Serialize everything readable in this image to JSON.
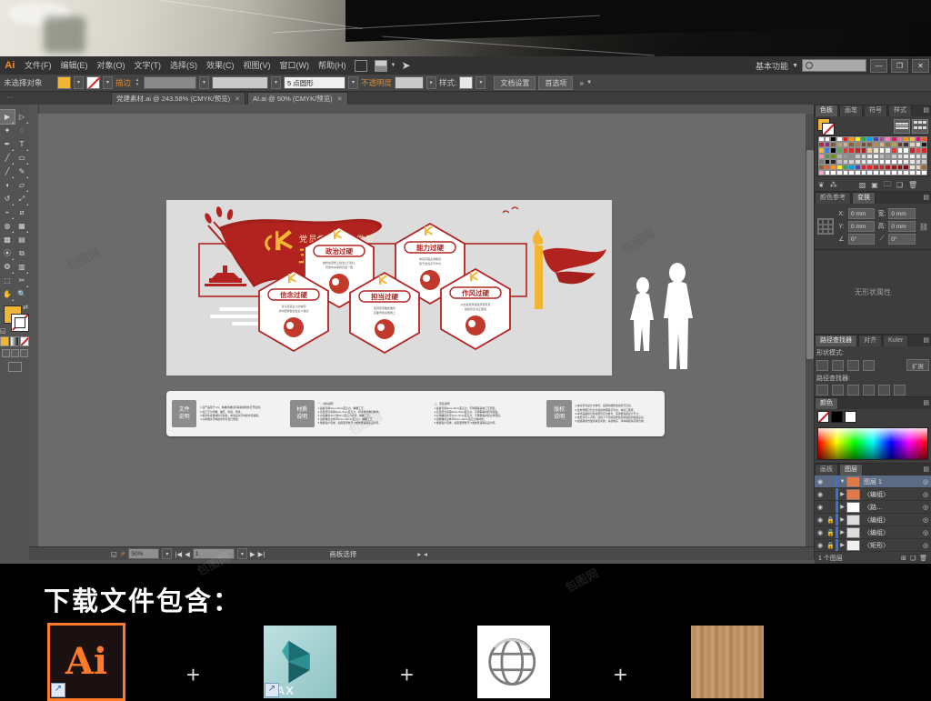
{
  "app": {
    "name": "Ai",
    "workspace": "基本功能",
    "search_placeholder": "",
    "window_buttons": [
      "—",
      "❐",
      "✕"
    ]
  },
  "menubar": {
    "items": [
      "文件(F)",
      "编辑(E)",
      "对象(O)",
      "文字(T)",
      "选择(S)",
      "效果(C)",
      "视图(V)",
      "窗口(W)",
      "帮助(H)"
    ],
    "bridge_icon": "bridge-icon",
    "arrange_icon": "arrange-documents-icon",
    "stock_icon": "stock-icon"
  },
  "optionsbar": {
    "selection_status": "未选择对象",
    "fill_label": "填色",
    "stroke_label": "描边",
    "stroke_weight": "5 点圆形",
    "opacity_label": "不透明度",
    "opacity_value": "100%",
    "style_label": "样式:",
    "doc_setup": "文档设置",
    "preferences": "首选项",
    "more_label": "»"
  },
  "tabs": [
    {
      "title": "党建素材.ai @ 243.58% (CMYK/预览)",
      "active": false,
      "close": "✕"
    },
    {
      "title": "AI.ai @ 50% (CMYK/预览)",
      "active": true,
      "close": "✕"
    }
  ],
  "toolbox": {
    "tools": [
      {
        "name": "selection-tool",
        "glyph": "▶",
        "selected": true
      },
      {
        "name": "direct-selection-tool",
        "glyph": "▷",
        "selected": false
      },
      {
        "name": "magic-wand-tool",
        "glyph": "✦",
        "selected": false
      },
      {
        "name": "lasso-tool",
        "glyph": "◌",
        "selected": false
      },
      {
        "name": "pen-tool",
        "glyph": "✒",
        "selected": false
      },
      {
        "name": "type-tool",
        "glyph": "T",
        "selected": false
      },
      {
        "name": "line-segment-tool",
        "glyph": "／",
        "selected": false
      },
      {
        "name": "rectangle-tool",
        "glyph": "▭",
        "selected": false
      },
      {
        "name": "paintbrush-tool",
        "glyph": "🖌",
        "selected": false
      },
      {
        "name": "pencil-tool",
        "glyph": "✎",
        "selected": false
      },
      {
        "name": "blob-brush-tool",
        "glyph": "◖",
        "selected": false
      },
      {
        "name": "eraser-tool",
        "glyph": "▱",
        "selected": false
      },
      {
        "name": "rotate-tool",
        "glyph": "↺",
        "selected": false
      },
      {
        "name": "scale-tool",
        "glyph": "⤢",
        "selected": false
      },
      {
        "name": "width-tool",
        "glyph": "⌁",
        "selected": false
      },
      {
        "name": "shape-builder-tool",
        "glyph": "◍",
        "selected": false
      },
      {
        "name": "perspective-grid-tool",
        "glyph": "▦",
        "selected": false
      },
      {
        "name": "mesh-tool",
        "glyph": "▤",
        "selected": false
      },
      {
        "name": "gradient-tool",
        "glyph": "▩",
        "selected": false
      },
      {
        "name": "eyedropper-tool",
        "glyph": "⦿",
        "selected": false
      },
      {
        "name": "blend-tool",
        "glyph": "⧉",
        "selected": false
      },
      {
        "name": "symbol-sprayer-tool",
        "glyph": "❂",
        "selected": false
      },
      {
        "name": "column-graph-tool",
        "glyph": "▥",
        "selected": false
      },
      {
        "name": "artboard-tool",
        "glyph": "⬚",
        "selected": false
      },
      {
        "name": "slice-tool",
        "glyph": "✂",
        "selected": false
      },
      {
        "name": "hand-tool",
        "glyph": "✋",
        "selected": false
      },
      {
        "name": "zoom-tool",
        "glyph": "🔍",
        "selected": false
      }
    ],
    "fill_color": "#f2b632",
    "stroke_color": "#ffffff",
    "swap_icon": "swap-fill-stroke-icon",
    "default_icon": "default-fill-stroke-icon"
  },
  "statusbar": {
    "zoom_value": "50%",
    "page_value": "1",
    "status_text": "画板选择",
    "prev_icon": "prev-icon",
    "next_icon": "next-icon"
  },
  "artwork": {
    "headline_small": "党员干部必须做到",
    "headline_big": "五个过硬",
    "hexes": [
      {
        "title": "政治过硬",
        "body": "始终在思想上政治上行动上同党中央保持高度一致"
      },
      {
        "title": "能力过硬",
        "body": "本领高强业务精湛勇于担当善于作为"
      },
      {
        "title": "担当过硬",
        "body": "坚持原则敢抓敢管直面矛盾迎难而上"
      },
      {
        "title": "信念过硬",
        "body": "对马克思主义的信仰对中国特色社会主义的信念"
      },
      {
        "title": "作风过硬",
        "body": "以优良党风促政风带民风勤政务实清正廉洁"
      }
    ],
    "info_blocks": [
      {
        "label": "文件\n说明",
        "lines": [
          "1.设产品用于:  CS、精雕浮雕刻字等常用软件打开使用。",
          "2.如工艺为浮雕、雕花、喷漆、烤漆。",
          "3.模文件多量材料与颜色，单击后文字内容均可编辑。",
          "4.以体图文字体颜色均可自行修改。"
        ]
      },
      {
        "label": "材质\n说明",
        "lines": [
          "一、材料说明",
          "1.底板可用3mm~5mm亚克力、精雕工艺。",
          "2.造型部分采用3mm~5mm亚克力，烤漆或者雕刻制作。",
          "3.文案雕刻3mm到5mm亚克力烤漆，精雕工艺。",
          "4.边框雕刻立体字5mm~10mm亚克力，精雕工艺",
          "5.根据客户需求，如需要调整尺寸或效果请联系设计师，我们可提供免费修改。"
        ]
      },
      {
        "label": "",
        "lines": [
          "二、安装说明",
          "1.底板可用3mm~5mm亚克力、不锈钢等多种工艺安装。",
          "2.造型部分采用3mm~5mm亚克力，不锈钢等材质背胶贴。",
          "3.立体雕刻文字3mm~5mm亚克力，不锈钢等材质立体安装。",
          "4.边框雕刻立体字5mm~10mm亚克力等材质。",
          "5.根据客户需求，如需要调整尺寸或效果请联系设计师，我们可提供免费修改。"
        ]
      },
      {
        "label": "版权\n说明",
        "lines": [
          "1.本文件为设计方参考，如需中国修改请另行洽谈。",
          "2.此效果图只代表方案的效果展示平台，非加工图纸。",
          "3.本作品版权归作者所有仅为参考，需详细沟通设计尺寸，制作方提供施工单。",
          "4.未经许可入声明，任何人不可擅自修改及转载如约侵权必究 (请商议授权)。",
          "5.如遇其他方面需求及问题，请在购买、详单等相关问题咨询，我们诚挚合作作品的设计作品。"
        ]
      }
    ]
  },
  "panels": {
    "swatches": {
      "tabs": [
        "色板",
        "画笔",
        "符号",
        "样式"
      ],
      "active_tab": "色板",
      "menu_icon": "panel-menu-icon",
      "list_view_icon": "list-view-icon",
      "grid_view_icon": "grid-view-icon",
      "footer_icons": [
        "swatch-library-icon",
        "color-group-icon",
        "show-kinds-icon",
        "swatch-options-icon",
        "new-color-group-icon",
        "new-swatch-icon",
        "delete-swatch-icon"
      ],
      "colors": [
        "#ffffff",
        "#ffffff",
        "#000000",
        "#ffffff",
        "#ed1c24",
        "#f7941e",
        "#fff200",
        "#22b14c",
        "#00a2e8",
        "#3f48cc",
        "#a349a4",
        "#ff7fbf",
        "#ed145b",
        "#f06eaa",
        "#f7941e",
        "#fdbb30",
        "#ec008c",
        "#f15a24",
        "#c1272d",
        "#93278f",
        "#7a5c3e",
        "#b9a074",
        "#c7b299",
        "#8c6239",
        "#a67c52",
        "#6f4e37",
        "#7d5a3c",
        "#b08d57",
        "#d9b382",
        "#8a6f48",
        "#b5a642",
        "#5c4033",
        "#3b2f2f",
        "#e6d2b5",
        "#efe3cf",
        "#1b1b1b",
        "#f2b632",
        "#2b7fff",
        "#000000",
        "#4caf50",
        "#e53935",
        "#d32f2f",
        "#c62828",
        "#b71c1c",
        "#e0c9a6",
        "#f1e2c6",
        "#ffffff",
        "#e9e9e9",
        "#ff2d2d",
        "#ffffff",
        "#ffffff",
        "#d42020",
        "#ef4444",
        "#dc2626",
        "#ff8fab",
        "#4e944f",
        "#6b8e23",
        "#b0b0b0",
        "#9a9a9a",
        "#8a8a8a",
        "#c8c8c8",
        "#d8d8d8",
        "#e8e8e8",
        "#f0f0f0",
        "#bdbdbd",
        "#a0a0a0",
        "#cccccc",
        "#dddddd",
        "#eeeeee",
        "#f5f5f5",
        "#e2e2e2",
        "#cfcfcf",
        "#7a7a7a",
        "#111111",
        "#2b2b2b",
        "#bdbdbd",
        "#c9c9c9",
        "#d4d4d4",
        "#dedede",
        "#e6e6e6",
        "#ededed",
        "#f2f2f2",
        "#f7f7f7",
        "#fafafa",
        "#fdfdfd",
        "#ffffff",
        "#f0efee",
        "#e8e6e3",
        "#dcd8d2",
        "#cfcac3",
        "#8c6239",
        "#f15a24",
        "#f7941e",
        "#fff200",
        "#22b14c",
        "#00a2e8",
        "#3f48cc",
        "#ed1c24",
        "#ed1c24",
        "#d42020",
        "#c62828",
        "#b71c1c",
        "#a31515",
        "#8f1111",
        "#7a0e0e",
        "#f3e7d8",
        "#e8d5bc",
        "#9b6b43",
        "#ff9ec7",
        "#ffffff",
        "#ffffff",
        "#ffffff",
        "#ffffff",
        "#ffffff",
        "#ffffff",
        "#ffffff",
        "#ffffff",
        "#ffffff",
        "#ffffff",
        "#ffffff",
        "#ffffff",
        "#ffffff",
        "#ffffff",
        "#ffffff",
        "#ffffff",
        "#ffffff"
      ]
    },
    "transform": {
      "tabs": [
        "颜色参考",
        "变换"
      ],
      "active_tab": "变换",
      "fields": [
        {
          "label": "X:",
          "value": "0 mm"
        },
        {
          "label": "宽:",
          "value": "0 mm"
        },
        {
          "label": "Y:",
          "value": "0 mm"
        },
        {
          "label": "高:",
          "value": "0 mm"
        },
        {
          "label": "∠",
          "value": "0°"
        },
        {
          "label": "⟋",
          "value": "0°"
        }
      ],
      "proxy_icon": "reference-point-proxy",
      "constrain_icon": "constrain-proportions-icon"
    },
    "appearance": {
      "empty_text": "无形状属性"
    },
    "pathfinder": {
      "tabs": [
        "路径查找器",
        "对齐",
        "Kuler"
      ],
      "active_tab": "路径查找器",
      "shape_modes_label": "形状模式:",
      "pathfinders_label": "路径查找器:",
      "expand_label": "扩展"
    },
    "color": {
      "tabs": [
        "颜色"
      ],
      "active_tab": "颜色",
      "none_swatch": "none-swatch",
      "black_swatch": "#000000",
      "white_swatch": "#ffffff"
    },
    "layers": {
      "tabs": [
        "画板",
        "图层"
      ],
      "active_tab": "图层",
      "rows": [
        {
          "name": "图层 1",
          "selected": true,
          "locked": false,
          "expanded": true,
          "thumb": "#e07a4a"
        },
        {
          "name": "〈编组〉",
          "selected": false,
          "locked": false,
          "expanded": false,
          "thumb": "#e07a4a"
        },
        {
          "name": "〈路…",
          "selected": false,
          "locked": false,
          "expanded": false,
          "thumb": "#ffffff"
        },
        {
          "name": "〈编组〉",
          "selected": false,
          "locked": true,
          "expanded": false,
          "thumb": "#dddddd"
        },
        {
          "name": "〈编组〉",
          "selected": false,
          "locked": true,
          "expanded": false,
          "thumb": "#dddddd"
        },
        {
          "name": "〈矩形〉",
          "selected": false,
          "locked": true,
          "expanded": false,
          "thumb": "#f0f0f0"
        }
      ],
      "footer_text": "1 个图层"
    }
  },
  "promo": {
    "title": "下载文件包含：",
    "plus": "+",
    "items": [
      {
        "name": "ai-file-icon",
        "label": "Ai",
        "kind": "ai"
      },
      {
        "name": "3dsmax-file-icon",
        "label": "MAX",
        "kind": "max"
      },
      {
        "name": "web-file-icon",
        "label": "",
        "kind": "web"
      },
      {
        "name": "wood-material-icon",
        "label": "",
        "kind": "wood"
      }
    ]
  },
  "watermark": {
    "text": "包图网"
  }
}
